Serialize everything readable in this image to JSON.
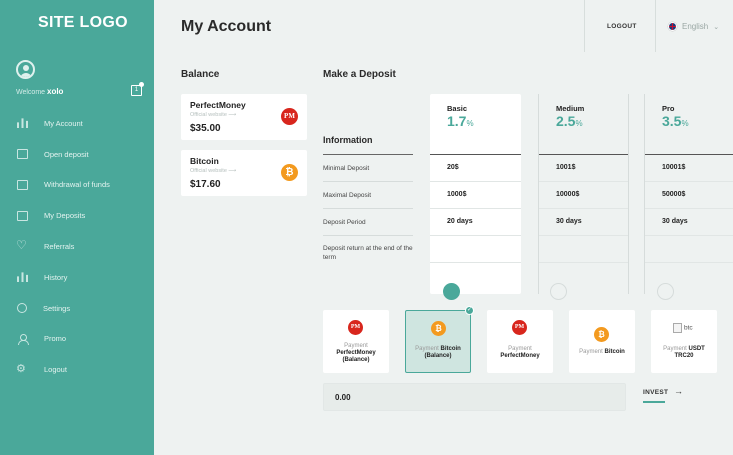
{
  "sidebar": {
    "logo": "SITE LOGO",
    "welcome_label": "Welcome",
    "username": "xolo",
    "notification_icon": "bell-icon",
    "items": [
      {
        "label": "My Account",
        "icon": "bars-chart-icon"
      },
      {
        "label": "Open deposit",
        "icon": "wallet-icon"
      },
      {
        "label": "Withdrawal of funds",
        "icon": "cash-withdraw-icon"
      },
      {
        "label": "My Deposits",
        "icon": "deposits-box-icon"
      },
      {
        "label": "Referrals",
        "icon": "heart-icon"
      },
      {
        "label": "History",
        "icon": "chart-icon"
      },
      {
        "label": "Settings",
        "icon": "settings-clock-icon"
      },
      {
        "label": "Promo",
        "icon": "user-icon"
      },
      {
        "label": "Logout",
        "icon": "gear-icon"
      }
    ]
  },
  "header": {
    "title": "My Account",
    "logout": "LOGOUT",
    "language": "English"
  },
  "balance": {
    "title": "Balance",
    "cards": [
      {
        "name": "PerfectMoney",
        "site": "Official website",
        "amount": "$35.00",
        "badge": "PM"
      },
      {
        "name": "Bitcoin",
        "site": "Official website",
        "amount": "$17.60",
        "badge": "₿"
      }
    ]
  },
  "deposit": {
    "title": "Make a Deposit",
    "info_title": "Information",
    "rows": [
      "Minimal Deposit",
      "Maximal Deposit",
      "Deposit Period",
      "Deposit return at the end of the term"
    ],
    "plans": [
      {
        "name": "Basic",
        "rate": "1.7",
        "unit": "%",
        "min": "20$",
        "max": "1000$",
        "period": "20 days",
        "selected": true
      },
      {
        "name": "Medium",
        "rate": "2.5",
        "unit": "%",
        "min": "1001$",
        "max": "10000$",
        "period": "30 days",
        "selected": false
      },
      {
        "name": "Pro",
        "rate": "3.5",
        "unit": "%",
        "min": "10001$",
        "max": "50000$",
        "period": "30 days",
        "selected": false
      }
    ],
    "payments": [
      {
        "prefix": "Payment",
        "name": "PerfectMoney",
        "suffix": "(Balance)",
        "badge": "PM"
      },
      {
        "prefix": "Payment",
        "name": "Bitcoin",
        "suffix": "(Balance)",
        "badge": "₿"
      },
      {
        "prefix": "Payment",
        "name": "PerfectMoney",
        "suffix": "",
        "badge": "PM"
      },
      {
        "prefix": "Payment",
        "name": "Bitcoin",
        "suffix": "",
        "badge": "₿"
      },
      {
        "prefix": "Payment",
        "name": "USDT TRC20",
        "suffix": "",
        "badge": "btc"
      }
    ],
    "amount_value": "0.00",
    "invest_label": "INVEST",
    "invest_arrow": "→"
  },
  "colors": {
    "accent": "#4aa89a",
    "pm": "#d8261d",
    "btc": "#f39a1f"
  }
}
